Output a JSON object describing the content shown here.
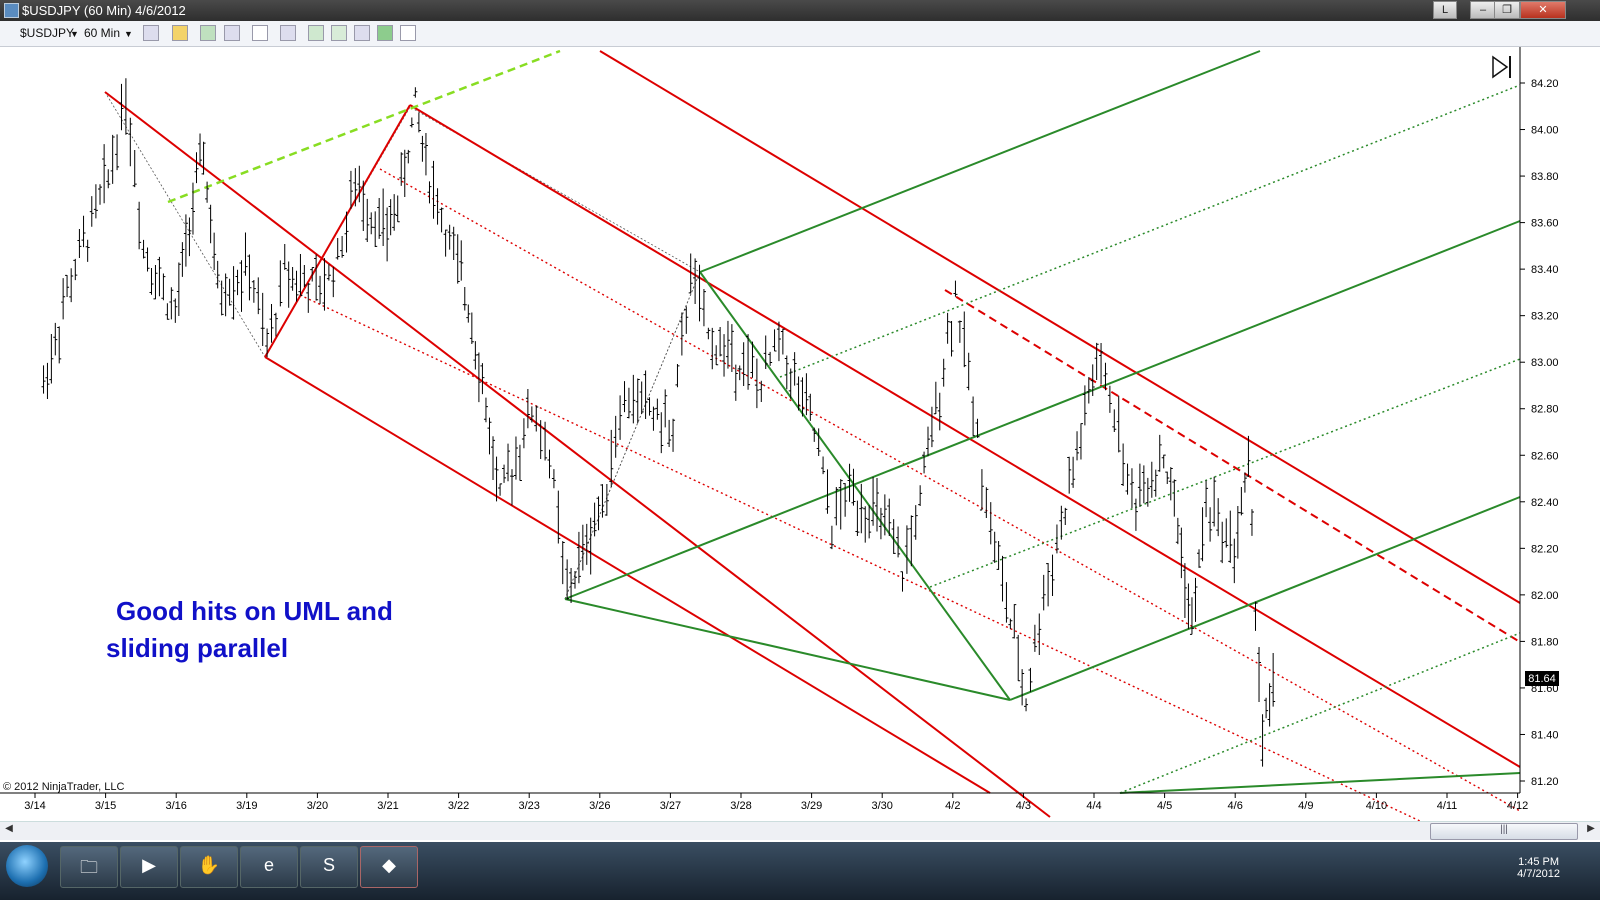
{
  "window": {
    "title": "$USDJPY (60 Min)  4/6/2012",
    "buttons": {
      "layout": "L",
      "minimize": "–",
      "restore": "❐",
      "close": "✕"
    }
  },
  "toolbar": {
    "instrument": "$USDJPY",
    "interval": "60 Min"
  },
  "chart_data": {
    "type": "bar",
    "title": "",
    "instrument": "$USDJPY",
    "interval": "60 Min",
    "copyright": "© 2012 NinjaTrader, LLC",
    "ylim": [
      81.1,
      84.3
    ],
    "yticks": [
      "84.20",
      "84.00",
      "83.80",
      "83.60",
      "83.40",
      "83.20",
      "83.00",
      "82.80",
      "82.60",
      "82.40",
      "82.20",
      "82.00",
      "81.80",
      "81.60",
      "81.40",
      "81.20"
    ],
    "xticks": [
      "3/14",
      "3/15",
      "3/16",
      "3/19",
      "3/20",
      "3/21",
      "3/22",
      "3/23",
      "3/26",
      "3/27",
      "3/28",
      "3/29",
      "3/30",
      "4/2",
      "4/3",
      "4/4",
      "4/5",
      "4/6",
      "4/9",
      "4/10",
      "4/11",
      "4/12"
    ],
    "last_price": "81.64",
    "annotation": [
      "Good hits on UML and",
      "sliding parallel"
    ],
    "price_path": [
      [
        "3/14",
        82.9
      ],
      [
        "3/14",
        83.3
      ],
      [
        "3/15",
        83.8
      ],
      [
        "3/15",
        84.15
      ],
      [
        "3/15",
        83.5
      ],
      [
        "3/16",
        83.2
      ],
      [
        "3/16",
        83.6
      ],
      [
        "3/16",
        83.9
      ],
      [
        "3/16",
        83.3
      ],
      [
        "3/19",
        83.4
      ],
      [
        "3/19",
        83.05
      ],
      [
        "3/19",
        83.4
      ],
      [
        "3/20",
        83.3
      ],
      [
        "3/20",
        83.45
      ],
      [
        "3/20",
        83.75
      ],
      [
        "3/21",
        83.55
      ],
      [
        "3/21",
        83.75
      ],
      [
        "3/21",
        84.1
      ],
      [
        "3/21",
        83.8
      ],
      [
        "3/22",
        83.4
      ],
      [
        "3/22",
        83.2
      ],
      [
        "3/22",
        82.8
      ],
      [
        "3/22",
        82.4
      ],
      [
        "3/23",
        82.8
      ],
      [
        "3/23",
        82.6
      ],
      [
        "3/23",
        82.0
      ],
      [
        "3/26",
        82.4
      ],
      [
        "3/26",
        82.8
      ],
      [
        "3/26",
        82.85
      ],
      [
        "3/27",
        82.7
      ],
      [
        "3/27",
        83.4
      ],
      [
        "3/27",
        83.1
      ],
      [
        "3/28",
        83.0
      ],
      [
        "3/28",
        82.9
      ],
      [
        "3/28",
        83.1
      ],
      [
        "3/29",
        82.7
      ],
      [
        "3/29",
        82.3
      ],
      [
        "3/29",
        82.45
      ],
      [
        "3/30",
        82.3
      ],
      [
        "3/30",
        82.1
      ],
      [
        "3/30",
        82.4
      ],
      [
        "4/2",
        83.3
      ],
      [
        "4/2",
        82.8
      ],
      [
        "4/2",
        82.3
      ],
      [
        "4/3",
        81.55
      ],
      [
        "4/3",
        82.0
      ],
      [
        "4/3",
        82.3
      ],
      [
        "4/4",
        83.0
      ],
      [
        "4/4",
        82.8
      ],
      [
        "4/4",
        82.4
      ],
      [
        "4/5",
        82.6
      ],
      [
        "4/5",
        82.3
      ],
      [
        "4/5",
        81.85
      ],
      [
        "4/5",
        82.4
      ],
      [
        "4/6",
        82.2
      ],
      [
        "4/6",
        82.55
      ],
      [
        "4/6",
        81.4
      ],
      [
        "4/6",
        81.64
      ]
    ],
    "studies": [
      {
        "name": "Pitchfork red handle",
        "color": "#dd0000",
        "style": "solid",
        "points": [
          [
            "3/19",
            83.05
          ],
          [
            "3/21",
            84.08
          ]
        ]
      },
      {
        "name": "Red upper parallel",
        "color": "#dd0000",
        "style": "solid",
        "points": [
          [
            "3/15",
            84.15
          ],
          [
            "4/3",
            81.2
          ]
        ]
      },
      {
        "name": "Red median line",
        "color": "#dd0000",
        "style": "solid",
        "points": [
          [
            "3/21",
            84.08
          ],
          [
            "4/12",
            81.25
          ]
        ]
      },
      {
        "name": "Red lower parallel",
        "color": "#dd0000",
        "style": "solid",
        "points": [
          [
            "3/19",
            83.05
          ],
          [
            "4/3",
            81.2
          ]
        ]
      },
      {
        "name": "Red upper median line",
        "color": "#dd0000",
        "style": "solid",
        "points": [
          [
            "3/26",
            84.3
          ],
          [
            "4/12",
            82.0
          ]
        ]
      },
      {
        "name": "Green median line",
        "color": "#2a8a2a",
        "style": "solid",
        "points": [
          [
            "3/23",
            82.0
          ],
          [
            "4/12",
            83.6
          ]
        ]
      }
    ]
  },
  "taskbar": {
    "clock_time": "1:45 PM",
    "clock_date": "4/7/2012"
  }
}
